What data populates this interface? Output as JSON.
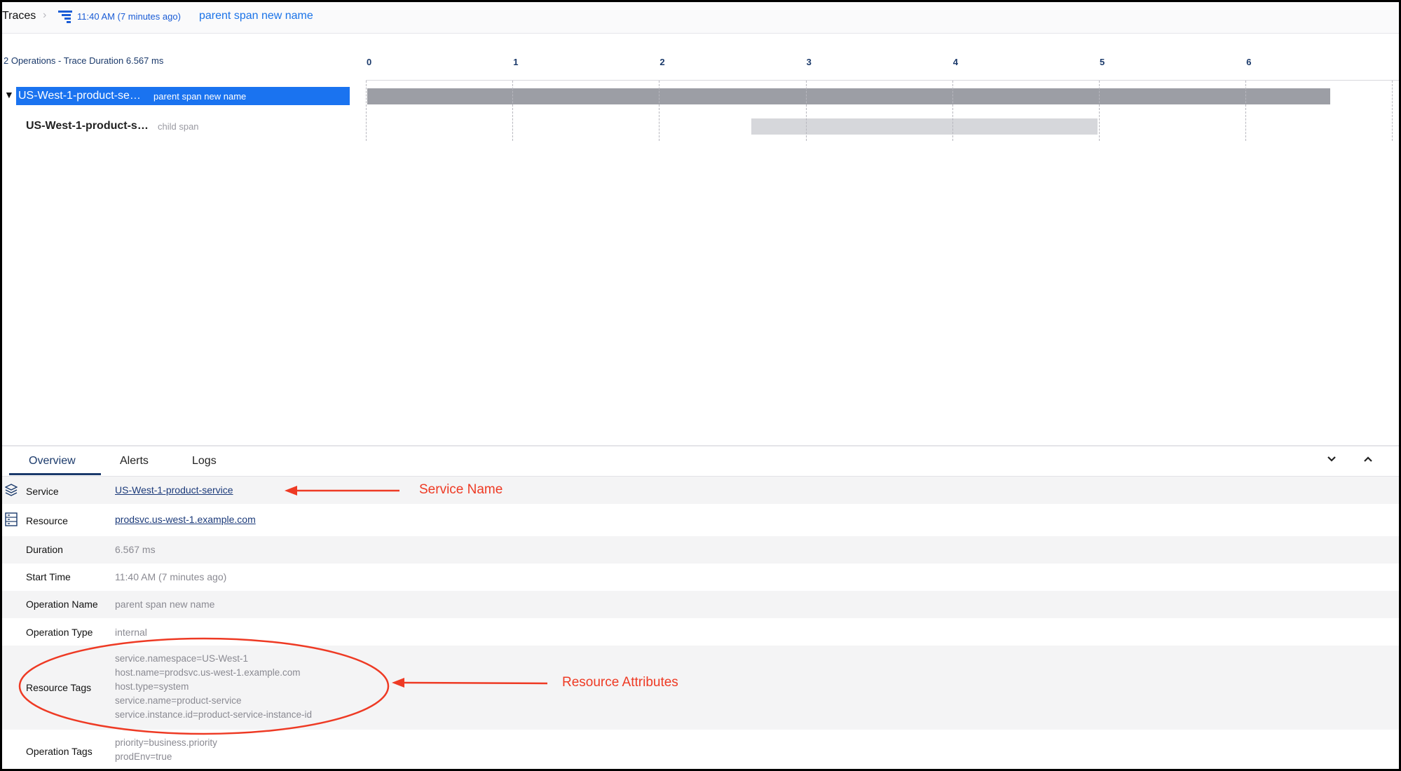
{
  "breadcrumb": {
    "root": "Traces",
    "separator": "›",
    "time": "11:40 AM  (7 minutes ago)",
    "title": "parent span new name"
  },
  "timeline": {
    "summary": "2 Operations - Trace Duration 6.567 ms",
    "ticks": [
      "0",
      "1",
      "2",
      "3",
      "4",
      "5",
      "6"
    ],
    "trace_duration_ms": 6.567,
    "spans": [
      {
        "service": "US-West-1-product-se…",
        "operation": "parent span new name",
        "start_ms": 0.0,
        "end_ms": 6.567,
        "selected": true
      },
      {
        "service": "US-West-1-product-s…",
        "operation": "child span",
        "start_ms": 2.62,
        "end_ms": 4.98,
        "selected": false
      }
    ]
  },
  "details": {
    "tabs": [
      "Overview",
      "Alerts",
      "Logs"
    ],
    "active_tab": "Overview",
    "service": {
      "label": "Service",
      "value": "US-West-1-product-service"
    },
    "resource": {
      "label": "Resource",
      "value": "prodsvc.us-west-1.example.com"
    },
    "duration": {
      "label": "Duration",
      "value": "6.567 ms"
    },
    "start_time": {
      "label": "Start Time",
      "value": "11:40 AM  (7 minutes ago)"
    },
    "operation_name": {
      "label": "Operation Name",
      "value": "parent span new name"
    },
    "operation_type": {
      "label": "Operation Type",
      "value": "internal"
    },
    "resource_tags": {
      "label": "Resource Tags",
      "values": [
        "service.namespace=US-West-1",
        "host.name=prodsvc.us-west-1.example.com",
        "host.type=system",
        "service.name=product-service",
        "service.instance.id=product-service-instance-id"
      ]
    },
    "operation_tags": {
      "label": "Operation Tags",
      "values": [
        "priority=business.priority",
        "prodEnv=true"
      ]
    }
  },
  "annotations": {
    "service_name": "Service Name",
    "resource_attributes": "Resource Attributes",
    "color": "#ee3a24"
  },
  "colors": {
    "selected_row": "#1a73f0",
    "parent_bar": "#9c9ea5",
    "child_bar": "#d6d7db",
    "link": "#1b3a7a",
    "axis_text": "#1b3a6b"
  }
}
